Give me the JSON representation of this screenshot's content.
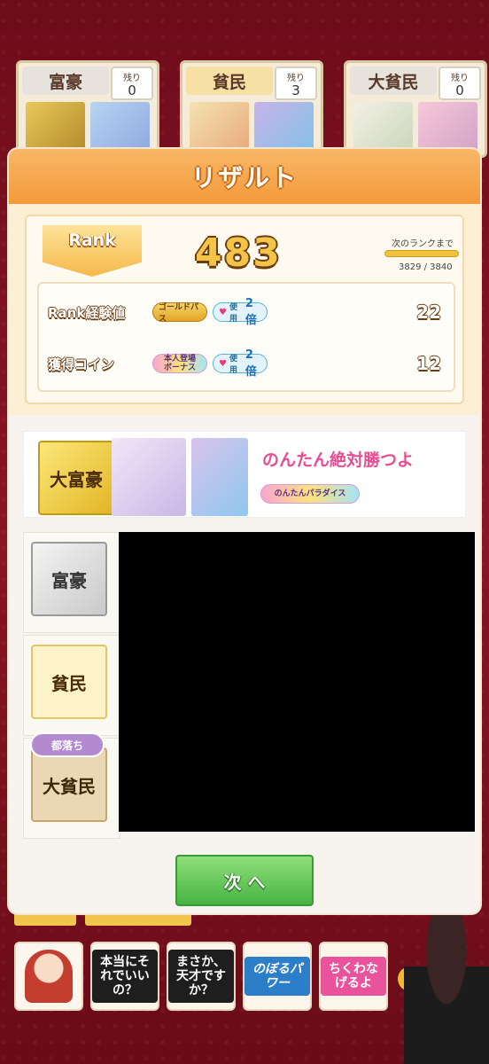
{
  "players": [
    {
      "rank": "富豪",
      "remain_label": "残り",
      "remain": "0",
      "color": "#e7e3dc"
    },
    {
      "rank": "貧民",
      "remain_label": "残り",
      "remain": "3",
      "color": "#f7e0a4"
    },
    {
      "rank": "大貧民",
      "remain_label": "残り",
      "remain": "0",
      "color": "#e7e3dc"
    }
  ],
  "modal": {
    "title": "リザルト",
    "rank_badge": "Rank",
    "rank_value": "483",
    "next_rank_label": "次のランクまで",
    "next_rank_progress": 0.997,
    "next_rank_count": "3829 / 3840",
    "rows": [
      {
        "label": "Rank経験値",
        "pill1": "ゴールドパス",
        "pill2_prefix": "使用",
        "pill2_mult": "2倍",
        "value": "22"
      },
      {
        "label": "獲得コイン",
        "pill1": "本人登場 ボーナス",
        "pill2_prefix": "使用",
        "pill2_mult": "2倍",
        "value": "12"
      }
    ]
  },
  "results": {
    "first_rank": "大富豪",
    "first_name": "のんたん絶対勝つよ",
    "first_badge": "のんたんパラダイス",
    "ranks": [
      "富豪",
      "貧民",
      "大貧民"
    ],
    "fall_tag": "都落ち"
  },
  "next_button": "次 へ",
  "stamps": [
    "本当にそれでいいの？",
    "まさか、天才ですか？",
    "のぼるパワー",
    "ちくわなげるよ"
  ],
  "colors": {
    "accent_orange": "#f39a3b",
    "pink_name": "#e84d93",
    "green_button": "#47b342"
  }
}
